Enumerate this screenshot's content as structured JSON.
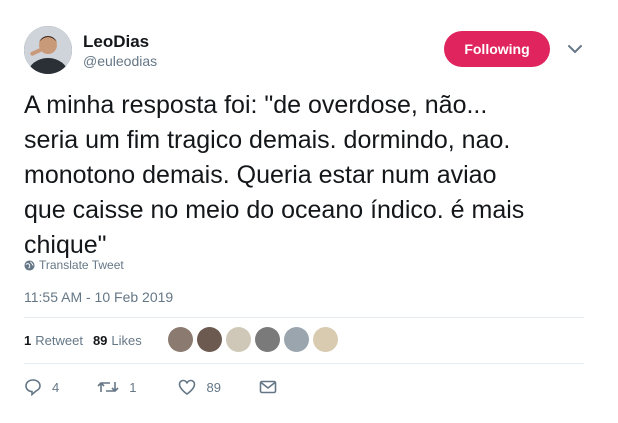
{
  "author": {
    "name": "LeoDias",
    "handle": "@euleodias"
  },
  "follow_button": {
    "label": "Following",
    "color": "#e0245e"
  },
  "tweet": {
    "text": "A minha resposta foi: \"de overdose, não...\nseria um fim tragico demais. dormindo, nao.\nmonotono demais. Queria estar num aviao\nque caisse no meio do oceano índico. é mais\nchique\"",
    "translate_label": "Translate Tweet",
    "timestamp": "11:55 AM - 10 Feb 2019"
  },
  "stats": {
    "retweets_count": "1",
    "retweets_label": "Retweet",
    "likes_count": "89",
    "likes_label": "Likes"
  },
  "actions": {
    "reply_count": "4",
    "retweet_count": "1",
    "like_count": "89"
  },
  "likers": [
    {
      "icon": "user-avatar-1",
      "color": "#8a7a70"
    },
    {
      "icon": "user-avatar-2",
      "color": "#6c5a50"
    },
    {
      "icon": "user-avatar-3",
      "color": "#cfc8b8"
    },
    {
      "icon": "user-avatar-4",
      "color": "#7a7a7a"
    },
    {
      "icon": "default-avatar",
      "color": "#9aa5ae"
    },
    {
      "icon": "user-avatar-6",
      "color": "#d8cbb0"
    }
  ],
  "colors": {
    "text": "#14171a",
    "muted": "#657786",
    "divider": "#e6ecf0"
  }
}
